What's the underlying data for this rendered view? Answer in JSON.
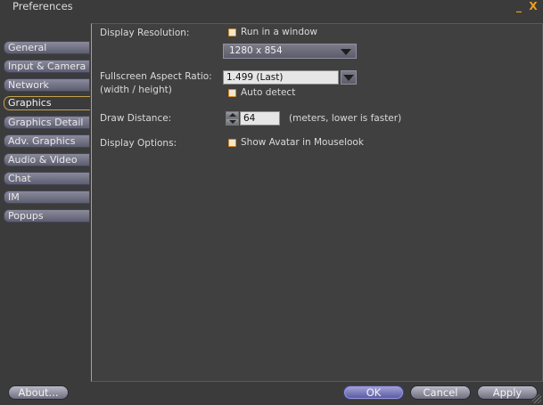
{
  "window": {
    "title": "Preferences",
    "minimize_glyph": "_",
    "close_glyph": "X"
  },
  "sidebar": {
    "tabs": [
      {
        "label": "General"
      },
      {
        "label": "Input & Camera"
      },
      {
        "label": "Network"
      },
      {
        "label": "Graphics"
      },
      {
        "label": "Graphics Detail"
      },
      {
        "label": "Adv. Graphics"
      },
      {
        "label": "Audio & Video"
      },
      {
        "label": "Chat"
      },
      {
        "label": "IM"
      },
      {
        "label": "Popups"
      }
    ],
    "active_index": 3
  },
  "graphics": {
    "display_resolution_label": "Display Resolution:",
    "run_in_window": {
      "label": "Run in a window",
      "checked": false
    },
    "resolution_value": "1280 x 854",
    "aspect_label": "Fullscreen Aspect Ratio:",
    "aspect_sublabel": "(width / height)",
    "aspect_value": "1.499 (Last)",
    "auto_detect": {
      "label": "Auto detect",
      "checked": false
    },
    "draw_distance_label": "Draw Distance:",
    "draw_distance_value": "64",
    "draw_distance_hint": "(meters, lower is faster)",
    "display_options_label": "Display Options:",
    "show_avatar": {
      "label": "Show Avatar in Mouselook",
      "checked": false
    }
  },
  "footer": {
    "about": "About...",
    "ok": "OK",
    "cancel": "Cancel",
    "apply": "Apply"
  },
  "colors": {
    "background": "#3b3b3b",
    "accent": "#c8a050",
    "checkbox_border": "#d08a2a",
    "button": "#6f6f7f"
  }
}
